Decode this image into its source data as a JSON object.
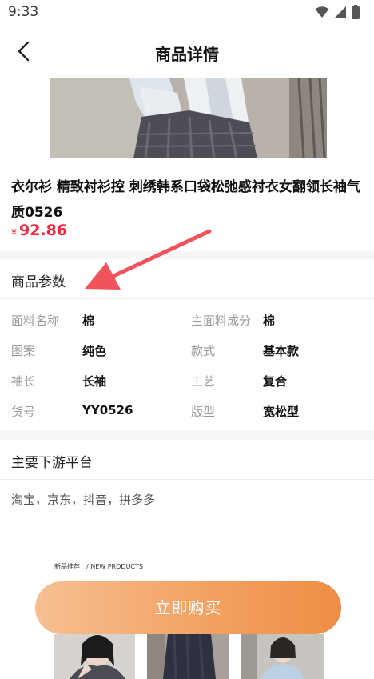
{
  "status_bar": {
    "time": "9:33"
  },
  "header": {
    "title": "商品详情"
  },
  "product": {
    "name": "衣尔衫 精致衬衫控 刺绣韩系口袋松弛感衬衣女翻领长袖气质0526",
    "currency": "¥",
    "price": "92.86"
  },
  "params_section": {
    "title": "商品参数",
    "rows": [
      {
        "label1": "面料名称",
        "value1": "棉",
        "label2": "主面料成分",
        "value2": "棉"
      },
      {
        "label1": "图案",
        "value1": "纯色",
        "label2": "款式",
        "value2": "基本款"
      },
      {
        "label1": "袖长",
        "value1": "长袖",
        "label2": "工艺",
        "value2": "复合"
      },
      {
        "label1": "货号",
        "value1": "YY0526",
        "label2": "版型",
        "value2": "宽松型"
      }
    ]
  },
  "platform_section": {
    "title": "主要下游平台",
    "content": "淘宝，京东，抖音，拼多多"
  },
  "new_products": {
    "label": "新品推荐　/ NEW PRODUCTS"
  },
  "buy_button": {
    "label": "立即购买"
  },
  "colors": {
    "accent": "#f0273d",
    "button_start": "#f6c092",
    "button_end": "#ee8e45",
    "arrow": "#f2525a"
  }
}
